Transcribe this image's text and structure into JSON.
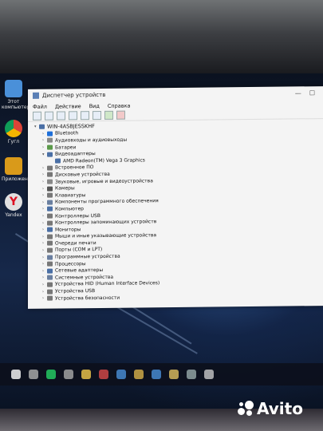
{
  "desktop": {
    "icons": [
      {
        "label": "Этот компьютер",
        "color": "#4a90d9"
      },
      {
        "label": "Гугл",
        "color": "#db4437"
      },
      {
        "label": "Приложения",
        "color": "#d99a1a"
      },
      {
        "label": "Yandex",
        "color": "#e0e0e0"
      }
    ]
  },
  "window": {
    "title": "Диспетчер устройств",
    "controls": [
      "—",
      "☐"
    ],
    "menu": [
      "Файл",
      "Действие",
      "Вид",
      "Справка"
    ],
    "toolbar_icons": [
      "back-icon",
      "forward-icon",
      "properties-icon",
      "help-icon",
      "scan-icon",
      "monitor-icon",
      "update-icon",
      "remove-icon"
    ],
    "tree": [
      {
        "label": "WIN-4ASBJESSKHF",
        "level": 0,
        "expanded": true,
        "color": "#4a6fa5"
      },
      {
        "label": "Bluetooth",
        "level": 1,
        "expanded": false,
        "color": "#1e6fd9"
      },
      {
        "label": "Аудиовходы и аудиовыходы",
        "level": 1,
        "expanded": false,
        "color": "#888888"
      },
      {
        "label": "Батареи",
        "level": 1,
        "expanded": false,
        "color": "#5b9a4a"
      },
      {
        "label": "Видеоадаптеры",
        "level": 1,
        "expanded": true,
        "color": "#4a6fa5"
      },
      {
        "label": "AMD Radeon(TM) Vega 3 Graphics",
        "level": 2,
        "expanded": null,
        "color": "#4a6fa5"
      },
      {
        "label": "Встроенное ПО",
        "level": 1,
        "expanded": false,
        "color": "#777777"
      },
      {
        "label": "Дисковые устройства",
        "level": 1,
        "expanded": false,
        "color": "#777777"
      },
      {
        "label": "Звуковые, игровые и видеоустройства",
        "level": 1,
        "expanded": false,
        "color": "#888888"
      },
      {
        "label": "Камеры",
        "level": 1,
        "expanded": false,
        "color": "#555555"
      },
      {
        "label": "Клавиатуры",
        "level": 1,
        "expanded": false,
        "color": "#777777"
      },
      {
        "label": "Компоненты программного обеспечения",
        "level": 1,
        "expanded": false,
        "color": "#6a7fa0"
      },
      {
        "label": "Компьютер",
        "level": 1,
        "expanded": false,
        "color": "#4a6fa5"
      },
      {
        "label": "Контроллеры USB",
        "level": 1,
        "expanded": false,
        "color": "#777777"
      },
      {
        "label": "Контроллеры запоминающих устройств",
        "level": 1,
        "expanded": false,
        "color": "#777777"
      },
      {
        "label": "Мониторы",
        "level": 1,
        "expanded": false,
        "color": "#4a6fa5"
      },
      {
        "label": "Мыши и иные указывающие устройства",
        "level": 1,
        "expanded": false,
        "color": "#777777"
      },
      {
        "label": "Очереди печати",
        "level": 1,
        "expanded": false,
        "color": "#777777"
      },
      {
        "label": "Порты (COM и LPT)",
        "level": 1,
        "expanded": false,
        "color": "#777777"
      },
      {
        "label": "Программные устройства",
        "level": 1,
        "expanded": false,
        "color": "#6a7fa0"
      },
      {
        "label": "Процессоры",
        "level": 1,
        "expanded": false,
        "color": "#777777"
      },
      {
        "label": "Сетевые адаптеры",
        "level": 1,
        "expanded": false,
        "color": "#4a6fa5"
      },
      {
        "label": "Системные устройства",
        "level": 1,
        "expanded": false,
        "color": "#6a7fa0"
      },
      {
        "label": "Устройства HID (Human Interface Devices)",
        "level": 1,
        "expanded": false,
        "color": "#777777"
      },
      {
        "label": "Устройства USB",
        "level": 1,
        "expanded": false,
        "color": "#777777"
      },
      {
        "label": "Устройства безопасности",
        "level": 1,
        "expanded": false,
        "color": "#777777"
      }
    ]
  },
  "taskbar": {
    "items": [
      "windows-icon",
      "camera-icon",
      "whatsapp-icon",
      "settings-icon",
      "yandex-icon",
      "music-icon",
      "chat-icon",
      "browser-icon",
      "mail-icon",
      "folder-icon",
      "store-icon",
      "device-manager-icon"
    ]
  },
  "watermark": {
    "text": "Avito"
  }
}
